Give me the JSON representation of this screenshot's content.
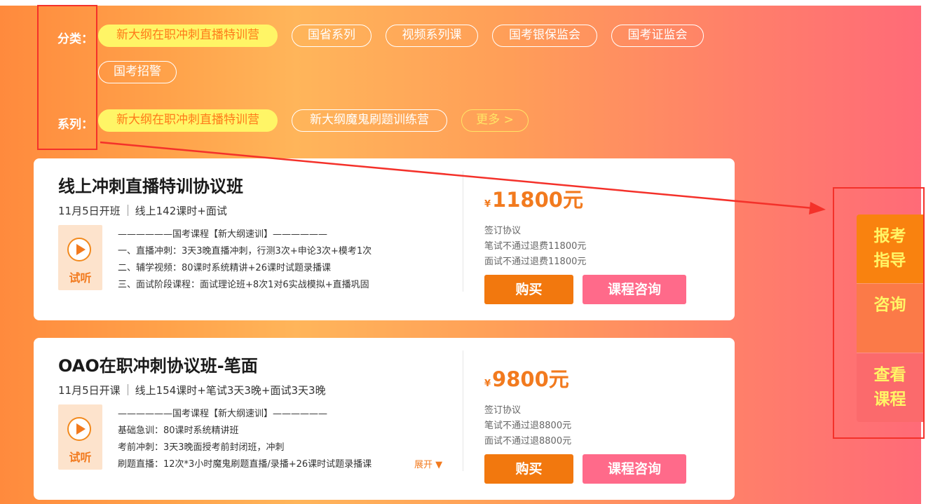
{
  "filters": {
    "category_label": "分类：",
    "category_items": [
      "新大纲在职冲刺直播特训营",
      "国省系列",
      "视频系列课",
      "国考银保监会",
      "国考证监会",
      "国考招警"
    ],
    "series_label": "系列：",
    "series_items": [
      "新大纲在职冲刺直播特训营",
      "新大纲魔鬼刷题训练营"
    ],
    "more_label": "更多 >"
  },
  "courses": [
    {
      "title": "线上冲刺直播特训协议班",
      "start": "11月5日开班",
      "hours": "线上142课时+面试",
      "trial_label": "试听",
      "desc": [
        "——————国考课程【新大纲速训】——————",
        "一、直播冲刺：3天3晚直播冲刺，行测3次+申论3次+模考1次",
        "二、辅学视频：80课时系统精讲+26课时试题录播课",
        "三、面试阶段课程：面试理论班+8次1对6实战模拟+直播巩固"
      ],
      "currency": "¥",
      "price": "11800元",
      "agreement": [
        "签订协议",
        "笔试不通过退费11800元",
        "面试不通过退费11800元"
      ],
      "buy_label": "购买",
      "consult_label": "课程咨询"
    },
    {
      "title": "OAO在职冲刺协议班-笔面",
      "start": "11月5日开课",
      "hours": "线上154课时+笔试3天3晚+面试3天3晚",
      "trial_label": "试听",
      "desc": [
        "——————国考课程【新大纲速训】——————",
        "基础急训：80课时系统精讲班",
        "考前冲刺：3天3晚面授考前封闭班，冲刺",
        "刷题直播：12次*3小时魔鬼刷题直播/录播+26课时试题录播课"
      ],
      "expand_label": "展开 ▼",
      "currency": "¥",
      "price": "9800元",
      "agreement": [
        "签订协议",
        "笔试不通过退8800元",
        "面试不通过退8800元"
      ],
      "buy_label": "购买",
      "consult_label": "课程咨询"
    }
  ],
  "side_panel": {
    "items": [
      "报考\n指导",
      "咨询",
      "查看\n课程"
    ],
    "colors": [
      "#f9820f",
      "#fb7a48",
      "#fb6a6c"
    ]
  },
  "colors": {
    "accent_orange": "#f2780e",
    "consult_pink": "#ff6a8a",
    "active_pill": "#fff566",
    "annotation_red": "#f4312a"
  }
}
